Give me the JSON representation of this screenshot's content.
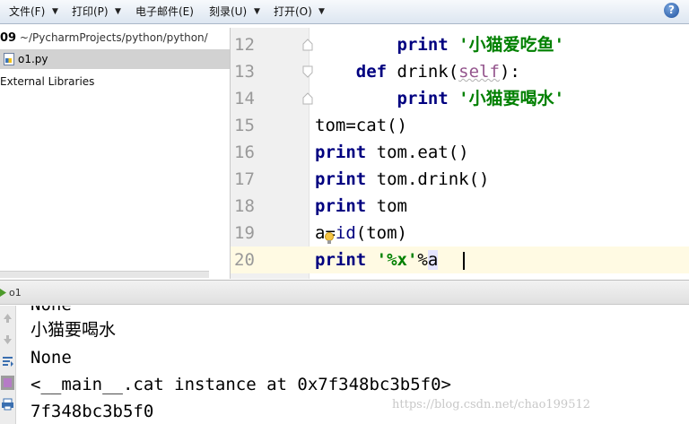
{
  "menubar": {
    "items": [
      {
        "label": "文件(F)"
      },
      {
        "label": "打印(P)"
      },
      {
        "label": "电子邮件(E)"
      },
      {
        "label": "刻录(U)"
      },
      {
        "label": "打开(O)"
      }
    ],
    "caret": "▼",
    "help": "?"
  },
  "project": {
    "root_number": "09",
    "root_path": " ~/PycharmProjects/python/python/",
    "file": "o1.py",
    "external_libraries": "External Libraries"
  },
  "editor": {
    "lines": [
      {
        "number": "12",
        "segments": [
          {
            "text": "        ",
            "kind": "plain"
          },
          {
            "text": "print",
            "kind": "kw"
          },
          {
            "text": " ",
            "kind": "plain"
          },
          {
            "text": "'小猫爱吃鱼'",
            "kind": "str"
          }
        ]
      },
      {
        "number": "13",
        "segments": [
          {
            "text": "    ",
            "kind": "plain"
          },
          {
            "text": "def",
            "kind": "kw"
          },
          {
            "text": " drink(",
            "kind": "plain"
          },
          {
            "text": "self",
            "kind": "self"
          },
          {
            "text": "):",
            "kind": "plain"
          }
        ]
      },
      {
        "number": "14",
        "segments": [
          {
            "text": "        ",
            "kind": "plain"
          },
          {
            "text": "print",
            "kind": "kw"
          },
          {
            "text": " ",
            "kind": "plain"
          },
          {
            "text": "'小猫要喝水'",
            "kind": "str"
          }
        ]
      },
      {
        "number": "15",
        "segments": [
          {
            "text": "tom=cat()",
            "kind": "plain"
          }
        ]
      },
      {
        "number": "16",
        "segments": [
          {
            "text": "print",
            "kind": "kw"
          },
          {
            "text": " tom.eat()",
            "kind": "plain"
          }
        ]
      },
      {
        "number": "17",
        "segments": [
          {
            "text": "print",
            "kind": "kw"
          },
          {
            "text": " tom.drink()",
            "kind": "plain"
          }
        ]
      },
      {
        "number": "18",
        "segments": [
          {
            "text": "print",
            "kind": "kw"
          },
          {
            "text": " tom",
            "kind": "plain"
          }
        ]
      },
      {
        "number": "19",
        "segments": [
          {
            "text": "a=",
            "kind": "plain"
          },
          {
            "text": "id",
            "kind": "builtin"
          },
          {
            "text": "(tom)",
            "kind": "plain"
          }
        ]
      },
      {
        "number": "20",
        "segments": [
          {
            "text": "print",
            "kind": "kw"
          },
          {
            "text": " ",
            "kind": "plain"
          },
          {
            "text": "'%x'",
            "kind": "str"
          },
          {
            "text": "%",
            "kind": "plain"
          },
          {
            "text": "a",
            "kind": "hl"
          }
        ]
      }
    ],
    "current_line": "20"
  },
  "run": {
    "label": "o1",
    "output": [
      "None",
      "小猫要喝水",
      "None",
      "<__main__.cat instance at 0x7f348bc3b5f0>",
      "7f348bc3b5f0"
    ]
  },
  "watermark": "https://blog.csdn.net/chao199512",
  "colors": {
    "keyword": "#000080",
    "string": "#008000",
    "self": "#94558d",
    "line_number": "#999999",
    "current_line": "#fffae3"
  }
}
